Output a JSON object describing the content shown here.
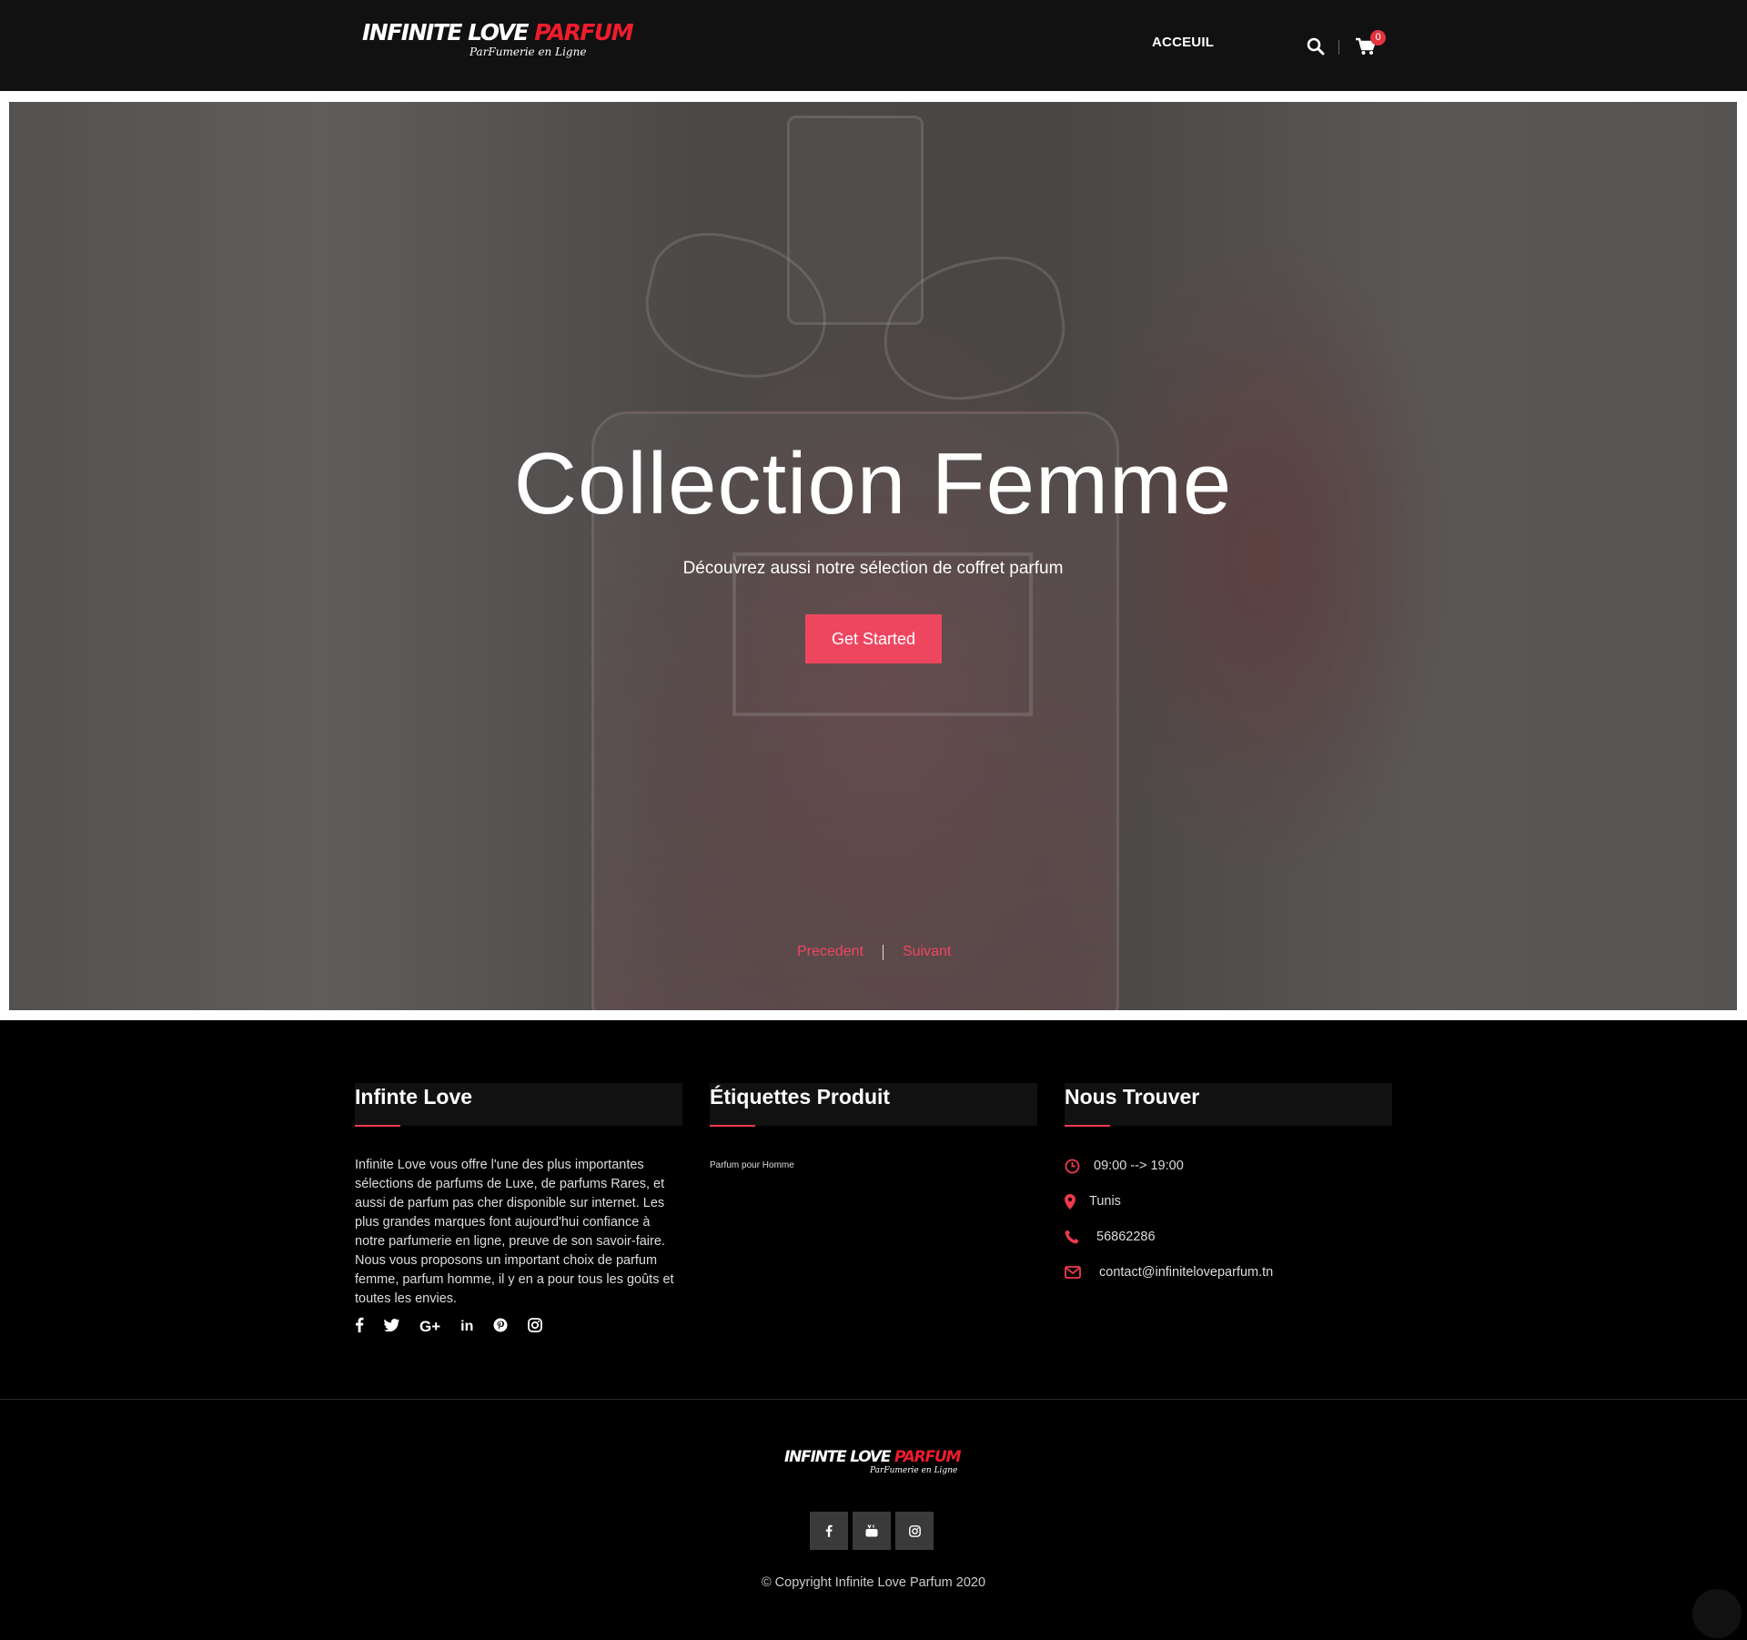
{
  "brand": {
    "logo_main_white": "INFINITE LOVE",
    "logo_main_red": "PARFUM",
    "logo_tagline": "ParFumerie en Ligne",
    "accent": "#ee3a4c",
    "button_color": "#ef4660"
  },
  "nav": {
    "accueil": "ACCEUIL",
    "cart_count": "0"
  },
  "hero": {
    "title": "Collection Femme",
    "subtitle": "Découvrez aussi notre sélection de coffret parfum",
    "cta": "Get Started",
    "prev": "Precedent",
    "next": "Suivant"
  },
  "footer": {
    "about": {
      "heading": "Infinte Love",
      "text": "Infinite Love vous offre l'une des plus importantes sélections de parfums de Luxe, de parfums Rares, et aussi de parfum pas cher disponible sur internet. Les plus grandes marques font aujourd'hui confiance à notre parfumerie en ligne, preuve de son savoir-faire. Nous vous proposons un important choix de parfum femme, parfum homme,  il y en a pour tous les goûts et toutes les envies.",
      "socials": [
        "facebook-icon",
        "twitter-icon",
        "google-plus-icon",
        "linkedin-icon",
        "pinterest-icon",
        "instagram-icon"
      ]
    },
    "tags": {
      "heading": "Étiquettes Produit",
      "items": [
        "Parfum pour Homme"
      ]
    },
    "contact": {
      "heading": "Nous Trouver",
      "hours": "09:00 --> 19:00",
      "city": "Tunis",
      "phone": "56862286",
      "email": "contact@infiniteloveparfum.tn"
    }
  },
  "bottom": {
    "logo_main_white": "INFINTE LOVE",
    "logo_main_red": "PARFUM",
    "logo_tagline": "ParFumerie en Ligne",
    "copyright": "© Copyright Infinite Love Parfum 2020"
  }
}
